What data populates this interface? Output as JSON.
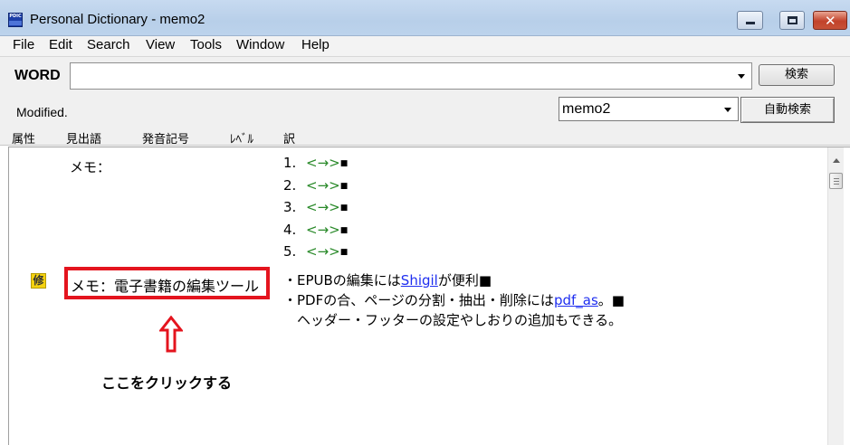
{
  "window": {
    "title": "Personal Dictionary - memo2",
    "app_icon": "pdic-app-icon"
  },
  "menu": [
    "File",
    "Edit",
    "Search",
    "View",
    "Tools",
    "Window",
    "Help"
  ],
  "word_bar": {
    "label": "WORD",
    "input_value": "",
    "search_button": "検索"
  },
  "status": {
    "text": "Modified.",
    "dictionary_selected": "memo2",
    "auto_search_button": "自動検索"
  },
  "columns": [
    "属性",
    "見出語",
    "発音記号",
    "ﾚﾍﾞﾙ",
    "訳"
  ],
  "entries": [
    {
      "headword": "メモ：",
      "items": [
        {
          "num": "1.",
          "text": "<→>"
        },
        {
          "num": "2.",
          "text": "<→>"
        },
        {
          "num": "3.",
          "text": "<→>"
        },
        {
          "num": "4.",
          "text": "<→>"
        },
        {
          "num": "5.",
          "text": "<→>"
        }
      ],
      "end_mark": "■"
    },
    {
      "attribute_badge": "修",
      "headword": "メモ：電子書籍の編集ツール",
      "def_lines": [
        {
          "pre": "・EPUBの編集には",
          "link": "Shigil",
          "post": "が便利■"
        },
        {
          "pre": "・PDFの合、ページの分割・抽出・削除には",
          "link": "pdf_as",
          "post": "。■"
        },
        {
          "pre": "　ヘッダー・フッターの設定やしおりの追加もできる。",
          "link": "",
          "post": ""
        }
      ]
    }
  ],
  "annotation": {
    "instruction": "ここをクリックする",
    "arrow_color": "#e4141e"
  }
}
